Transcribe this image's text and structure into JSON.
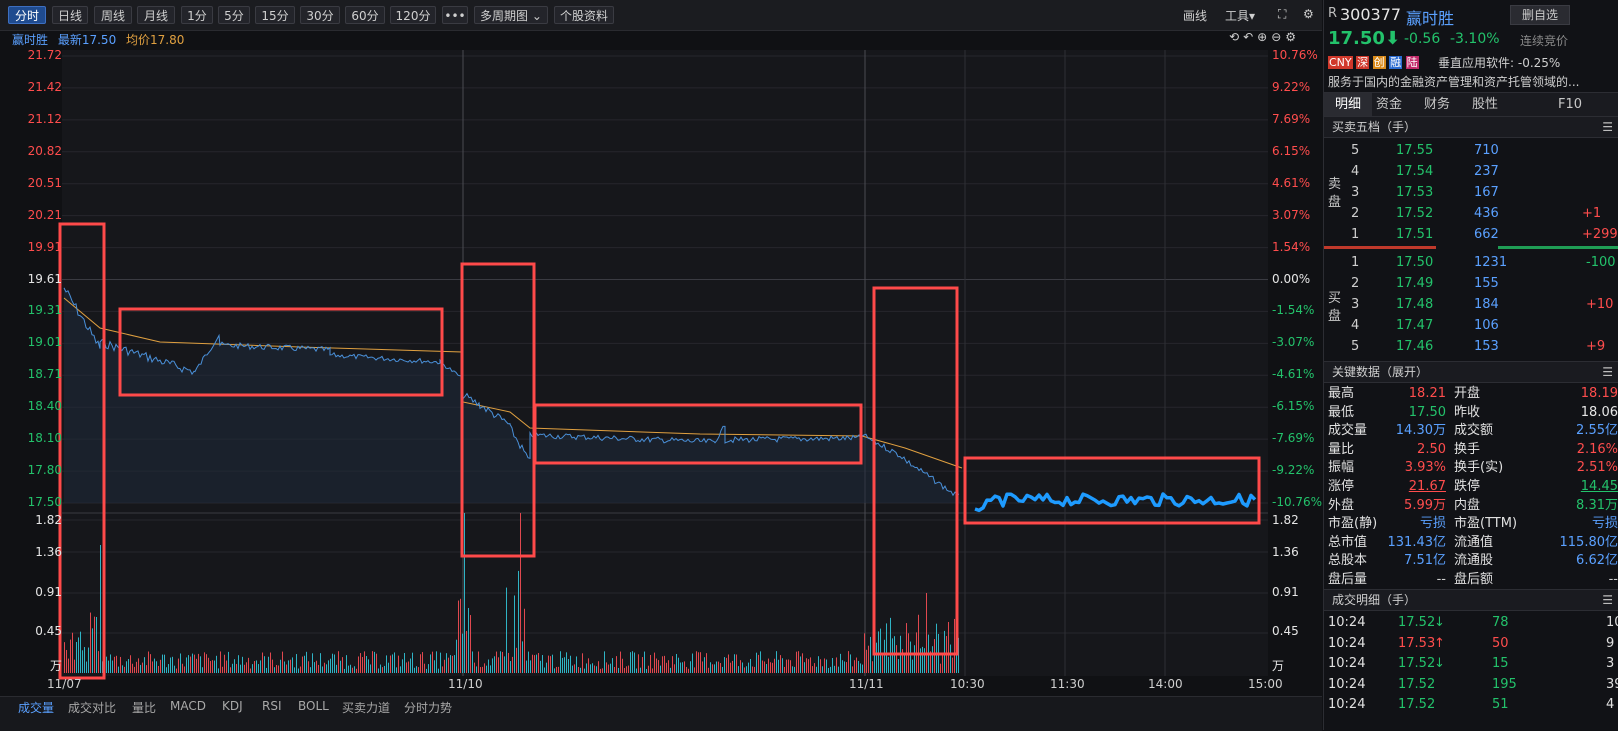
{
  "toolbar": {
    "buttons": [
      "分时",
      "日线",
      "周线",
      "月线",
      "1分",
      "5分",
      "15分",
      "30分",
      "60分",
      "120分",
      "•••",
      "多周期图",
      "个股资料"
    ],
    "right": [
      "画线",
      "工具",
      "⛶",
      "⚙",
      "»"
    ]
  },
  "legend": {
    "name": "赢时胜",
    "latest": "最新17.50",
    "avg": "均价17.80"
  },
  "price_axis": {
    "left": [
      "21.72",
      "21.42",
      "21.12",
      "20.82",
      "20.51",
      "20.21",
      "19.91",
      "19.61",
      "19.31",
      "19.01",
      "18.71",
      "18.40",
      "18.10",
      "17.80",
      "17.50"
    ],
    "right": [
      "10.76%",
      "9.22%",
      "7.69%",
      "6.15%",
      "4.61%",
      "3.07%",
      "1.54%",
      "0.00%",
      "-1.54%",
      "-3.07%",
      "-4.61%",
      "-6.15%",
      "-7.69%",
      "-9.22%",
      "-10.76%"
    ]
  },
  "volume_axis": {
    "labels": [
      "1.82",
      "1.36",
      "0.91",
      "0.45",
      "万"
    ]
  },
  "x_labels": [
    "11/07",
    "11/10",
    "11/11",
    "10:30",
    "11:30",
    "14:00",
    "15:00"
  ],
  "bottom_tabs": [
    "成交量",
    "成交对比",
    "量比",
    "MACD",
    "KDJ",
    "RSI",
    "BOLL",
    "买卖力道",
    "分时力势"
  ],
  "colors": {
    "up": "#ff4d4d",
    "down": "#23c26b",
    "price_line": "#4a90d9",
    "avg_line": "#e0a040",
    "highlight_box": "#ff4a4a",
    "today_line": "#1e9bff"
  },
  "stock": {
    "code": "300377",
    "name": "赢时胜",
    "r": "R",
    "price": "17.50",
    "change": "-0.56",
    "pct": "-3.10%",
    "add_button": "删自选",
    "auction": "连续竞价",
    "tags": [
      "CNY",
      "深",
      "创",
      "融",
      "陆"
    ],
    "sector": "垂直应用软件: -0.25%",
    "desc": "服务于国内的金融资产管理和资产托管领域的..."
  },
  "tabs": [
    "明细",
    "资金",
    "财务",
    "股性",
    "F10"
  ],
  "orderbook": {
    "title": "买卖五档（手）",
    "sell_label": "卖盘",
    "buy_label": "买盘",
    "asks": [
      {
        "lvl": "5",
        "p": "17.55",
        "v": "710",
        "d": ""
      },
      {
        "lvl": "4",
        "p": "17.54",
        "v": "237",
        "d": ""
      },
      {
        "lvl": "3",
        "p": "17.53",
        "v": "167",
        "d": ""
      },
      {
        "lvl": "2",
        "p": "17.52",
        "v": "436",
        "d": "+1"
      },
      {
        "lvl": "1",
        "p": "17.51",
        "v": "662",
        "d": "+299"
      }
    ],
    "bids": [
      {
        "lvl": "1",
        "p": "17.50",
        "v": "1231",
        "d": "-100"
      },
      {
        "lvl": "2",
        "p": "17.49",
        "v": "155",
        "d": ""
      },
      {
        "lvl": "3",
        "p": "17.48",
        "v": "184",
        "d": "+10"
      },
      {
        "lvl": "4",
        "p": "17.47",
        "v": "106",
        "d": ""
      },
      {
        "lvl": "5",
        "p": "17.46",
        "v": "153",
        "d": "+9"
      }
    ]
  },
  "keydata": {
    "title": "关键数据（展开）",
    "rows": [
      [
        "最高",
        "18.21",
        "开盘",
        "18.19"
      ],
      [
        "最低",
        "17.50",
        "昨收",
        "18.06"
      ],
      [
        "成交量",
        "14.30万",
        "成交额",
        "2.55亿"
      ],
      [
        "量比",
        "2.50",
        "换手",
        "2.16%"
      ],
      [
        "振幅",
        "3.93%",
        "换手(实)",
        "2.51%"
      ],
      [
        "涨停",
        "21.67",
        "跌停",
        "14.45"
      ],
      [
        "外盘",
        "5.99万",
        "内盘",
        "8.31万"
      ],
      [
        "市盈(静)",
        "亏损",
        "市盈(TTM)",
        "亏损"
      ],
      [
        "总市值",
        "131.43亿",
        "流通值",
        "115.80亿"
      ],
      [
        "总股本",
        "7.51亿",
        "流通股",
        "6.62亿"
      ],
      [
        "盘后量",
        "--",
        "盘后额",
        "--"
      ]
    ]
  },
  "trades": {
    "title": "成交明细（手）",
    "rows": [
      {
        "t": "10:24",
        "p": "17.52",
        "dir": "down",
        "v": "78",
        "n": "10"
      },
      {
        "t": "10:24",
        "p": "17.53",
        "dir": "up",
        "v": "50",
        "n": "9"
      },
      {
        "t": "10:24",
        "p": "17.52",
        "dir": "down",
        "v": "15",
        "n": "3"
      },
      {
        "t": "10:24",
        "p": "17.52",
        "dir": "",
        "v": "195",
        "n": "39"
      },
      {
        "t": "10:24",
        "p": "17.52",
        "dir": "",
        "v": "51",
        "n": "4"
      }
    ]
  }
}
